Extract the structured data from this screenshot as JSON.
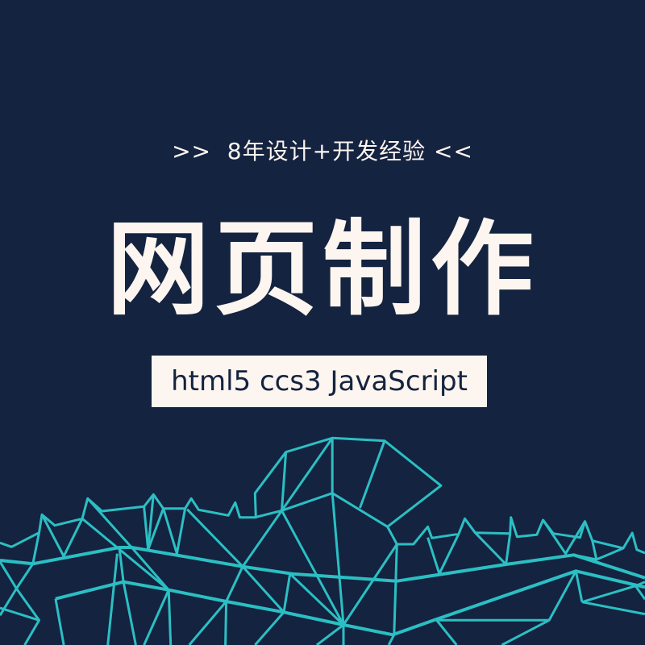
{
  "subtitle": ">>  8年设计+开发经验 <<",
  "title": "网页制作",
  "tagline": "html5 ccs3 JavaScript",
  "colors": {
    "background": "#14233f",
    "text": "#fdf5f0",
    "mesh": "#2bbfc4"
  },
  "decoration": "polygon-mesh-mountains"
}
